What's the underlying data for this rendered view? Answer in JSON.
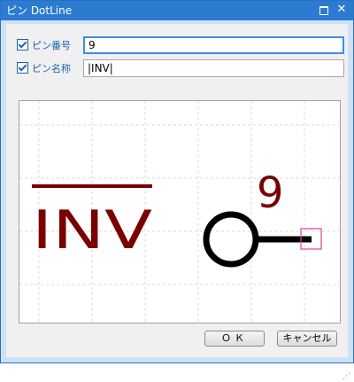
{
  "window": {
    "title": "ピン DotLine"
  },
  "pin_number": {
    "label": "ピン番号",
    "value": "9"
  },
  "pin_name": {
    "label": "ピン名称",
    "value": "|INV|"
  },
  "preview": {
    "pin_name_text": "INV",
    "pin_number_text": "9"
  },
  "buttons": {
    "ok": "ＯＫ",
    "cancel": "キャンセル"
  },
  "colors": {
    "accent": "#2b7bd1",
    "pin_text": "#7a0000",
    "pin_shape": "#000000",
    "pin_end_marker": "#e0409a",
    "grid": "#d8d8d8"
  }
}
